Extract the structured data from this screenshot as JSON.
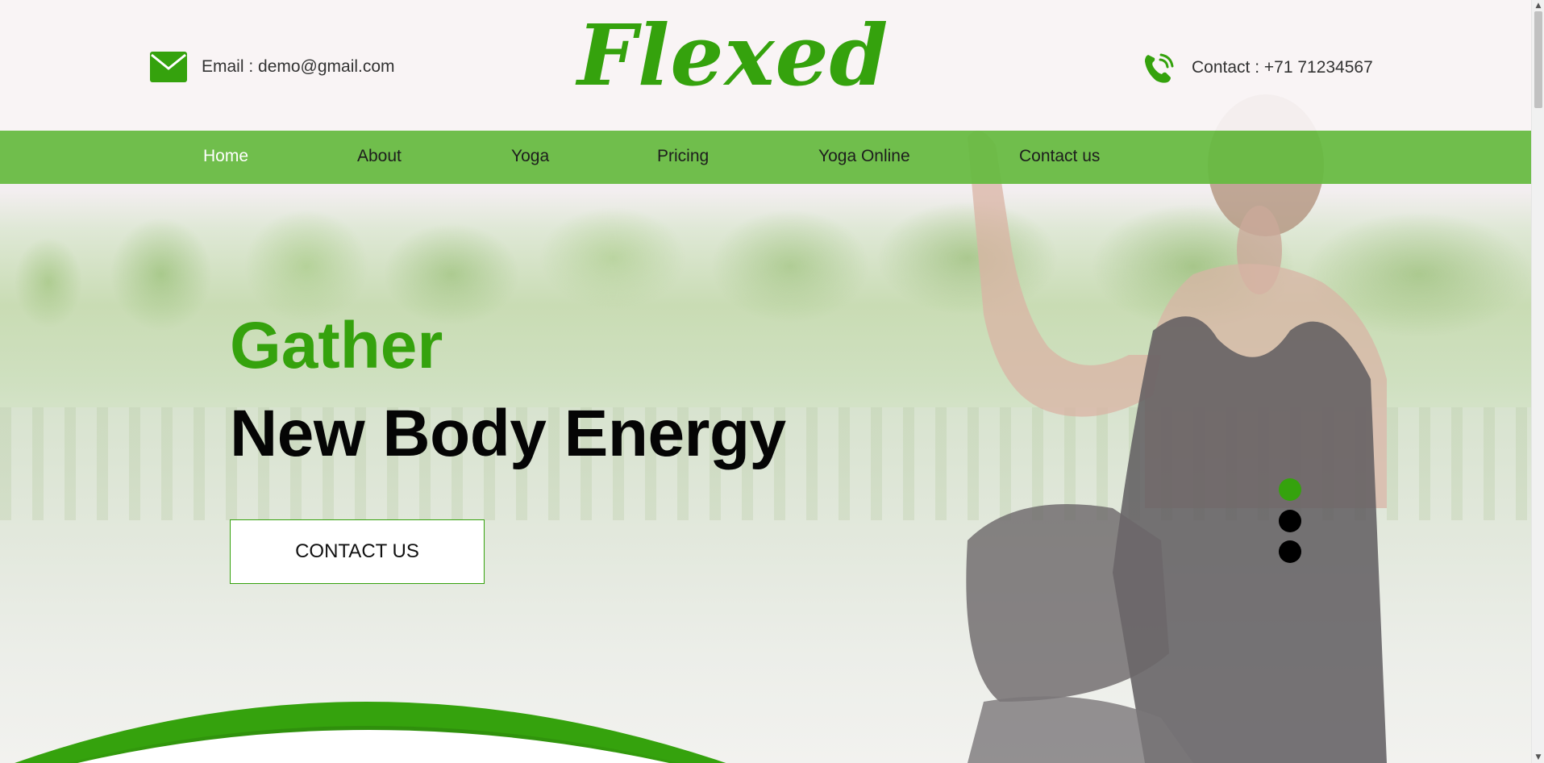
{
  "header": {
    "email_label": "Email : demo@gmail.com",
    "logo": "Flexed",
    "contact_label": "Contact : +71 71234567",
    "icons": {
      "email": "envelope-icon",
      "phone": "phone-icon"
    }
  },
  "nav": {
    "items": [
      {
        "label": "Home",
        "active": true
      },
      {
        "label": "About"
      },
      {
        "label": "Yoga"
      },
      {
        "label": "Pricing"
      },
      {
        "label": "Yoga Online"
      },
      {
        "label": "Contact us"
      }
    ]
  },
  "hero": {
    "kicker": "Gather",
    "title": "New Body Energy",
    "cta_label": "CONTACT US",
    "slides": {
      "count": 3,
      "active_index": 0
    }
  },
  "colors": {
    "brand_green": "#35a20d",
    "nav_green": "#65ba40",
    "nav_active_text": "#ffffff",
    "nav_text": "#1d1d1d"
  }
}
